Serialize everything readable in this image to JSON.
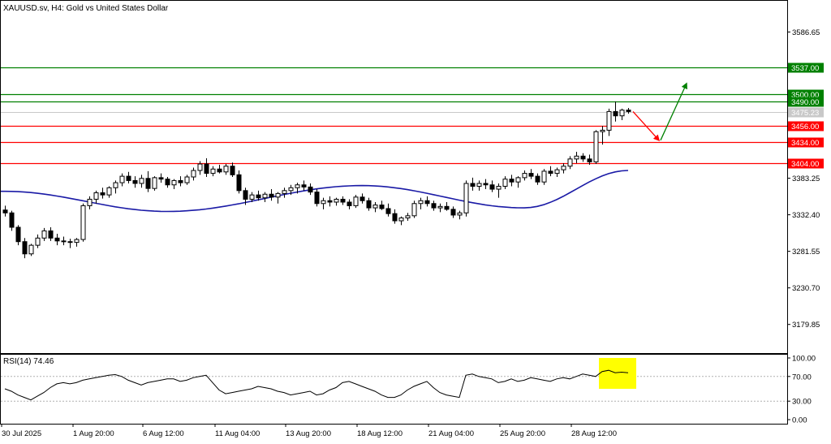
{
  "header": {
    "symbol": "XAUUSD.sv",
    "timeframe": "H4",
    "description": "Gold vs United States Dollar"
  },
  "colors": {
    "support": "#ff0000",
    "resistance": "#008000",
    "ma": "#1a1aa6",
    "candle": "#000000",
    "highlight": "#ffff00",
    "grid_text": "#000000"
  },
  "chart_data": [
    {
      "type": "candlestick",
      "title": "XAUUSD.sv, H4:  Gold vs United States Dollar",
      "y_ticks": [
        "3586.65",
        "3383.25",
        "3332.40",
        "3281.55",
        "3230.70",
        "3179.85"
      ],
      "ylim": [
        3140,
        3630
      ],
      "x_ticks": [
        "30 Jul 2025",
        "1 Aug 20:00",
        "6 Aug 12:00",
        "11 Aug 04:00",
        "13 Aug 20:00",
        "18 Aug 12:00",
        "21 Aug 04:00",
        "25 Aug 20:00",
        "28 Aug 12:00"
      ],
      "current_price": "3475.23",
      "levels": [
        {
          "price": "3537.00",
          "value": 3537,
          "kind": "resistance"
        },
        {
          "price": "3500.00",
          "value": 3500,
          "kind": "resistance"
        },
        {
          "price": "3490.00",
          "value": 3490,
          "kind": "resistance"
        },
        {
          "price": "3456.00",
          "value": 3456,
          "kind": "support"
        },
        {
          "price": "3434.00",
          "value": 3434,
          "kind": "support"
        },
        {
          "price": "3404.00",
          "value": 3404,
          "kind": "support"
        }
      ],
      "projection": [
        {
          "from": 3476,
          "to": 3436,
          "direction": "down"
        },
        {
          "from": 3436,
          "to": 3515,
          "direction": "up"
        }
      ],
      "candles": [
        [
          3339,
          3345,
          3330,
          3335
        ],
        [
          3335,
          3338,
          3310,
          3315
        ],
        [
          3315,
          3318,
          3290,
          3295
        ],
        [
          3295,
          3300,
          3272,
          3278
        ],
        [
          3278,
          3292,
          3275,
          3290
        ],
        [
          3290,
          3305,
          3286,
          3300
        ],
        [
          3300,
          3314,
          3296,
          3310
        ],
        [
          3310,
          3315,
          3296,
          3300
        ],
        [
          3300,
          3306,
          3290,
          3296
        ],
        [
          3296,
          3302,
          3290,
          3295
        ],
        [
          3295,
          3299,
          3286,
          3294
        ],
        [
          3294,
          3300,
          3288,
          3298
        ],
        [
          3298,
          3348,
          3295,
          3345
        ],
        [
          3345,
          3358,
          3340,
          3354
        ],
        [
          3354,
          3366,
          3348,
          3363
        ],
        [
          3363,
          3370,
          3355,
          3360
        ],
        [
          3360,
          3372,
          3356,
          3370
        ],
        [
          3370,
          3380,
          3362,
          3377
        ],
        [
          3377,
          3390,
          3372,
          3386
        ],
        [
          3386,
          3392,
          3376,
          3380
        ],
        [
          3380,
          3386,
          3370,
          3376
        ],
        [
          3376,
          3388,
          3370,
          3383
        ],
        [
          3383,
          3393,
          3364,
          3369
        ],
        [
          3369,
          3386,
          3366,
          3384
        ],
        [
          3384,
          3390,
          3377,
          3382
        ],
        [
          3382,
          3385,
          3370,
          3374
        ],
        [
          3374,
          3382,
          3368,
          3380
        ],
        [
          3380,
          3386,
          3372,
          3377
        ],
        [
          3377,
          3388,
          3374,
          3385
        ],
        [
          3385,
          3398,
          3380,
          3394
        ],
        [
          3394,
          3407,
          3388,
          3403
        ],
        [
          3403,
          3411,
          3385,
          3390
        ],
        [
          3390,
          3400,
          3386,
          3396
        ],
        [
          3396,
          3402,
          3390,
          3392
        ],
        [
          3392,
          3403,
          3388,
          3400
        ],
        [
          3400,
          3405,
          3385,
          3388
        ],
        [
          3388,
          3394,
          3362,
          3366
        ],
        [
          3366,
          3370,
          3346,
          3354
        ],
        [
          3354,
          3364,
          3350,
          3360
        ],
        [
          3360,
          3366,
          3352,
          3356
        ],
        [
          3356,
          3364,
          3350,
          3361
        ],
        [
          3361,
          3368,
          3352,
          3357
        ],
        [
          3357,
          3364,
          3348,
          3362
        ],
        [
          3362,
          3370,
          3356,
          3366
        ],
        [
          3366,
          3374,
          3360,
          3370
        ],
        [
          3370,
          3377,
          3362,
          3374
        ],
        [
          3374,
          3380,
          3366,
          3371
        ],
        [
          3371,
          3376,
          3360,
          3364
        ],
        [
          3364,
          3368,
          3344,
          3348
        ],
        [
          3348,
          3356,
          3340,
          3352
        ],
        [
          3352,
          3358,
          3344,
          3350
        ],
        [
          3350,
          3356,
          3345,
          3354
        ],
        [
          3354,
          3358,
          3346,
          3350
        ],
        [
          3350,
          3354,
          3340,
          3345
        ],
        [
          3345,
          3360,
          3342,
          3357
        ],
        [
          3357,
          3362,
          3348,
          3352
        ],
        [
          3352,
          3356,
          3338,
          3342
        ],
        [
          3342,
          3350,
          3336,
          3346
        ],
        [
          3346,
          3352,
          3339,
          3341
        ],
        [
          3341,
          3348,
          3330,
          3334
        ],
        [
          3334,
          3340,
          3320,
          3324
        ],
        [
          3324,
          3330,
          3318,
          3328
        ],
        [
          3328,
          3335,
          3324,
          3331
        ],
        [
          3331,
          3352,
          3328,
          3348
        ],
        [
          3348,
          3356,
          3340,
          3352
        ],
        [
          3352,
          3358,
          3344,
          3348
        ],
        [
          3348,
          3352,
          3338,
          3342
        ],
        [
          3342,
          3348,
          3336,
          3344
        ],
        [
          3344,
          3350,
          3338,
          3340
        ],
        [
          3340,
          3344,
          3328,
          3332
        ],
        [
          3332,
          3338,
          3326,
          3335
        ],
        [
          3335,
          3380,
          3330,
          3376
        ],
        [
          3376,
          3384,
          3366,
          3372
        ],
        [
          3372,
          3380,
          3366,
          3376
        ],
        [
          3376,
          3382,
          3368,
          3374
        ],
        [
          3374,
          3380,
          3364,
          3368
        ],
        [
          3368,
          3376,
          3356,
          3372
        ],
        [
          3372,
          3386,
          3368,
          3382
        ],
        [
          3382,
          3388,
          3372,
          3378
        ],
        [
          3378,
          3386,
          3370,
          3384
        ],
        [
          3384,
          3394,
          3380,
          3390
        ],
        [
          3390,
          3396,
          3382,
          3386
        ],
        [
          3386,
          3390,
          3374,
          3378
        ],
        [
          3378,
          3396,
          3374,
          3393
        ],
        [
          3393,
          3400,
          3386,
          3390
        ],
        [
          3390,
          3398,
          3385,
          3395
        ],
        [
          3395,
          3404,
          3390,
          3400
        ],
        [
          3400,
          3414,
          3396,
          3410
        ],
        [
          3410,
          3420,
          3404,
          3414
        ],
        [
          3414,
          3418,
          3406,
          3410
        ],
        [
          3410,
          3416,
          3402,
          3406
        ],
        [
          3406,
          3450,
          3403,
          3448
        ],
        [
          3448,
          3456,
          3430,
          3450
        ],
        [
          3450,
          3480,
          3442,
          3476
        ],
        [
          3476,
          3490,
          3462,
          3470
        ],
        [
          3470,
          3480,
          3464,
          3478
        ],
        [
          3478,
          3481,
          3473,
          3476
        ]
      ],
      "ma": {
        "period": 50,
        "start": 3365,
        "dip_value": 3337,
        "dip_index": 25,
        "mid_value": 3373,
        "mid_index": 55,
        "trough_value": 3342,
        "trough_index": 80,
        "end_value": 3394
      }
    },
    {
      "type": "line",
      "title": "RSI(14) 74.46",
      "y_ticks": [
        "100.00",
        "70.00",
        "30.00",
        "0.00"
      ],
      "ylim": [
        0,
        100
      ],
      "levels": [
        70,
        30
      ],
      "values": [
        50,
        46,
        40,
        36,
        32,
        38,
        44,
        52,
        58,
        60,
        58,
        60,
        64,
        66,
        68,
        70,
        72,
        73,
        70,
        64,
        60,
        56,
        60,
        62,
        64,
        66,
        66,
        62,
        64,
        68,
        70,
        72,
        60,
        48,
        42,
        44,
        46,
        48,
        50,
        54,
        52,
        50,
        46,
        44,
        40,
        42,
        44,
        46,
        40,
        42,
        48,
        52,
        60,
        62,
        58,
        54,
        50,
        46,
        40,
        36,
        36,
        40,
        48,
        54,
        58,
        62,
        52,
        44,
        40,
        38,
        36,
        72,
        74,
        70,
        68,
        66,
        60,
        62,
        66,
        62,
        64,
        68,
        66,
        64,
        62,
        66,
        68,
        66,
        70,
        74,
        72,
        70,
        78,
        80,
        76,
        77,
        76
      ]
    }
  ]
}
